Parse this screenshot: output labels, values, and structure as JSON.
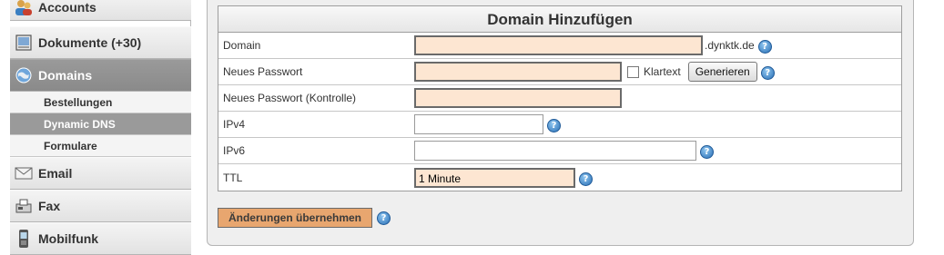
{
  "sidebar": {
    "items": [
      {
        "label": "Accounts",
        "icon": "users-icon"
      },
      {
        "label": "Dokumente (+30)",
        "icon": "document-icon"
      },
      {
        "label": "Domains",
        "icon": "globe-icon"
      },
      {
        "label": "Email",
        "icon": "envelope-icon"
      },
      {
        "label": "Fax",
        "icon": "fax-icon"
      },
      {
        "label": "Mobilfunk",
        "icon": "mobile-phone-icon"
      }
    ],
    "subitems": [
      {
        "label": "Bestellungen"
      },
      {
        "label": "Dynamic DNS"
      },
      {
        "label": "Formulare"
      }
    ]
  },
  "form": {
    "title": "Domain Hinzufügen",
    "rows": {
      "domain": {
        "label": "Domain",
        "value": "",
        "suffix": ".dynktk.de"
      },
      "password": {
        "label": "Neues Passwort",
        "value": "",
        "checkbox_label": "Klartext",
        "button_label": "Generieren"
      },
      "password_confirm": {
        "label": "Neues Passwort (Kontrolle)",
        "value": ""
      },
      "ipv4": {
        "label": "IPv4",
        "value": ""
      },
      "ipv6": {
        "label": "IPv6",
        "value": ""
      },
      "ttl": {
        "label": "TTL",
        "value": "1 Minute"
      }
    },
    "submit_label": "Änderungen übernehmen",
    "help_glyph": "?"
  },
  "colors": {
    "required_field_bg": "#fde6d2",
    "submit_bg": "#e8a66f",
    "active_nav_bg": "#8a8a8a",
    "help_icon_blue": "#2a6fb5"
  }
}
